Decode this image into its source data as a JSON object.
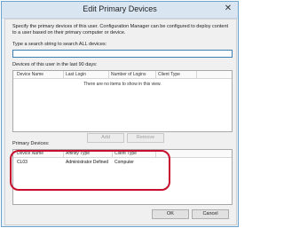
{
  "dialog": {
    "title": "Edit Primary Devices",
    "close_symbol": "✕",
    "description": "Specify the primary devices of this user. Configuration Manager can be configured to deploy content to a user based on their primary computer or device."
  },
  "search": {
    "label": "Type a search string to search ALL devices:",
    "value": ""
  },
  "recent_devices": {
    "label": "Devices of this user in the last 90 days:",
    "columns": [
      "Device Name",
      "Last Login",
      "Number of Logins",
      "Client Type"
    ],
    "empty_message": "There are no items to show in this view."
  },
  "actions": {
    "add_label": "Add",
    "remove_label": "Remove"
  },
  "primary_devices": {
    "label": "Primary Devices:",
    "columns": [
      "Device Name",
      "Affinity Type",
      "Client Type"
    ],
    "rows": [
      {
        "device_name": "CL03",
        "affinity_type": "Administrator Defined",
        "client_type": "Computer"
      }
    ]
  },
  "footer": {
    "ok_label": "OK",
    "cancel_label": "Cancel"
  },
  "colors": {
    "highlight": "#c8102e",
    "input_border": "#3c7fb1"
  }
}
